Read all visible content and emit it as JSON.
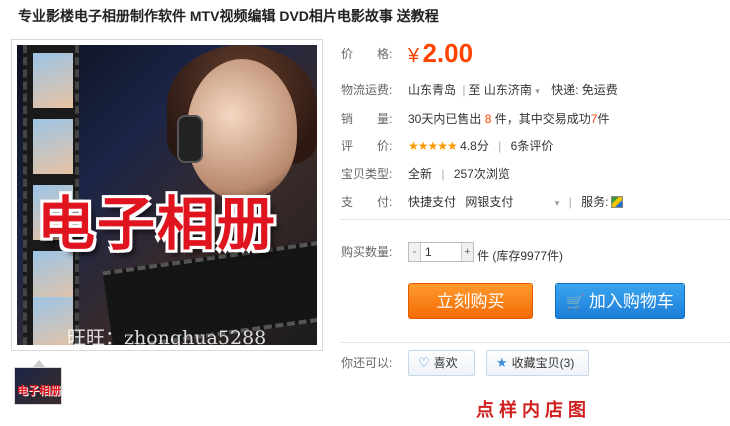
{
  "title": "专业影楼电子相册制作软件 MTV视频编辑 DVD相片电影故事 送教程",
  "image": {
    "logo_text": "电子相册",
    "watermark": "旺旺：zhonghua5288",
    "thumb_text": "电子相册"
  },
  "price": {
    "label": "价　　格:",
    "symbol": "¥",
    "value": "2.00"
  },
  "shipping": {
    "label": "物流运费:",
    "from": "山东青岛",
    "to_label": "至",
    "to": "山东济南",
    "fee": "快递: 免运费"
  },
  "sales": {
    "label": "销　　量:",
    "text_1": "30天内已售出",
    "sold_count": "8",
    "text_2": "件，其中交易成功",
    "success_count": "7",
    "text_3": "件"
  },
  "rating": {
    "label": "评　　价:",
    "stars": "★★★★★",
    "score": "4.8分",
    "reviews": "6条评价"
  },
  "type": {
    "label": "宝贝类型:",
    "condition": "全新",
    "views": "257次浏览"
  },
  "payment": {
    "label": "支　　付:",
    "method_1": "快捷支付",
    "method_2": "网银支付",
    "service_label": "服务:"
  },
  "quantity": {
    "label": "购买数量:",
    "value": "1",
    "minus": "-",
    "plus": "+",
    "unit": "件",
    "stock": "(库存9977件)"
  },
  "buttons": {
    "buy": "立刻购买",
    "cart": "加入购物车"
  },
  "actions": {
    "label": "你还可以:",
    "like": "喜欢",
    "favorite": "收藏宝贝(3)"
  },
  "bottom_text": "点 样 内 店 图",
  "colors": {
    "price": "#ff4400",
    "buy_button": "#f46b06",
    "cart_button": "#1c7fd8"
  }
}
